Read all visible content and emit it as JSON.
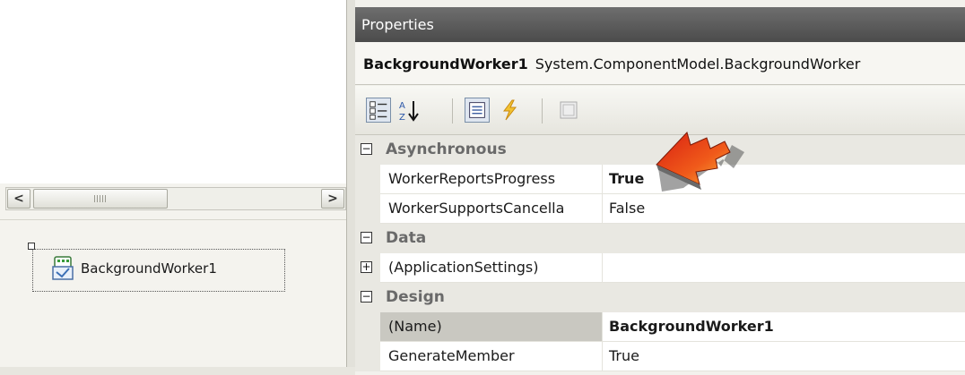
{
  "designer": {
    "component_label": "BackgroundWorker1",
    "scroll_grip": "III"
  },
  "properties": {
    "title": "Properties",
    "object_name": "BackgroundWorker1",
    "object_type": "System.ComponentModel.BackgroundWorker",
    "toolbar": [
      "categorized-icon",
      "alphabetical-icon",
      "properties-icon",
      "events-icon",
      "property-pages-icon"
    ],
    "grid": {
      "cat_async": {
        "label": "Asynchronous",
        "expander": "⊟"
      },
      "prop_progress": {
        "name": "WorkerReportsProgress",
        "value": "True"
      },
      "prop_cancel": {
        "name": "WorkerSupportsCancella",
        "value": "False"
      },
      "cat_data": {
        "label": "Data",
        "expander": "⊟"
      },
      "prop_appsettings": {
        "name": "(ApplicationSettings)",
        "value": "",
        "expander": "+"
      },
      "cat_design": {
        "label": "Design",
        "expander": "⊟"
      },
      "prop_name": {
        "name": "(Name)",
        "value": "BackgroundWorker1"
      },
      "prop_generate": {
        "name": "GenerateMember",
        "value": "True"
      }
    }
  },
  "colors": {
    "title_bar": "#5c5c5c",
    "arrow": "#e8491a"
  }
}
